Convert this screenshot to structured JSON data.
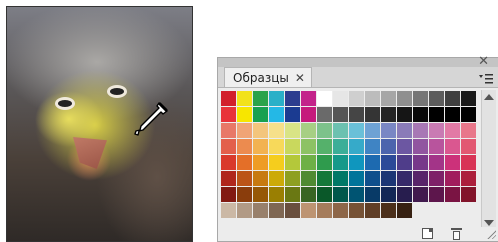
{
  "panel": {
    "tab_label": "Образцы",
    "tab_close": "✕",
    "panel_close": "✕",
    "menu_icon": "panel-menu-icon"
  },
  "swatches": [
    "#d21f2b",
    "#f2e21b",
    "#2aa34a",
    "#2ab0c8",
    "#2c3d8f",
    "#c3238a",
    "#ffffff",
    "#e6e6e6",
    "#cfcfcf",
    "#bcbcbc",
    "#a6a6a6",
    "#8f8f8f",
    "#767676",
    "#5c5c5c",
    "#3f3f3f",
    "#1a1a1a",
    "#e8333a",
    "#f7e600",
    "#17a050",
    "#24b8e6",
    "#1b3b91",
    "#c51a7c",
    "#6a6a6a",
    "#555555",
    "#454545",
    "#343434",
    "#242424",
    "#151515",
    "#090909",
    "#000000",
    "#000000",
    "#000000",
    "#e87868",
    "#f0a476",
    "#f3c57c",
    "#f6e08a",
    "#d9e486",
    "#a7cf84",
    "#7dc28b",
    "#6cc1b0",
    "#6ac0d8",
    "#6ea2d4",
    "#7a87c4",
    "#8a7bb8",
    "#a878b5",
    "#c97bb3",
    "#e27aa5",
    "#e8778a",
    "#e3604b",
    "#ec8b4f",
    "#f2b251",
    "#f7d95a",
    "#c9d85d",
    "#8dc264",
    "#55b16b",
    "#3cae98",
    "#36aac9",
    "#3f84c4",
    "#4c64ad",
    "#6c57a2",
    "#9155a0",
    "#b8549d",
    "#da5790",
    "#e25872",
    "#d93a2b",
    "#e46f28",
    "#ee9c25",
    "#f5cd1d",
    "#b4c83a",
    "#6eb046",
    "#2f9b4d",
    "#16998a",
    "#0f96be",
    "#1d6ab0",
    "#2c4a98",
    "#4f3d8a",
    "#77388a",
    "#a33488",
    "#cc317a",
    "#d83456",
    "#b0261c",
    "#bb5417",
    "#c77a10",
    "#ccaa08",
    "#8e9f21",
    "#4f8a32",
    "#14783a",
    "#007866",
    "#00749a",
    "#0f4f8c",
    "#1c3675",
    "#362a6a",
    "#58256a",
    "#7e2168",
    "#a11d5d",
    "#ac1f3c",
    "#821a12",
    "#8a3d0c",
    "#965806",
    "#9a7f02",
    "#6a7813",
    "#386523",
    "#0a5829",
    "#00574b",
    "#005472",
    "#083a67",
    "#132756",
    "#271d4e",
    "#411a4e",
    "#5d164c",
    "#7a1443",
    "#82142a",
    "#cbb8a5",
    "#b19a85",
    "#98806b",
    "#7f6753",
    "#694f3e",
    "#bd9472",
    "#a57c5b",
    "#8d6648",
    "#765236",
    "#603f27",
    "#4b2f1a",
    "#372112",
    "",
    "",
    "",
    ""
  ]
}
